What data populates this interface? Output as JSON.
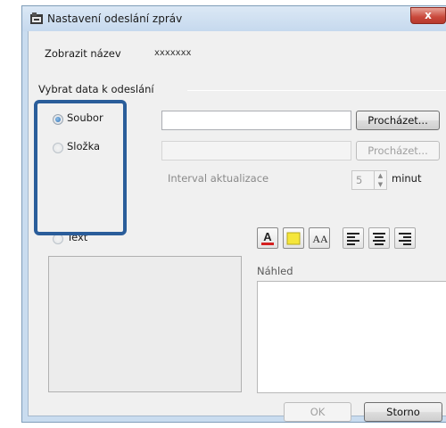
{
  "window": {
    "title": "Nastavení odeslání zpráv",
    "close_symbol": "x"
  },
  "display_name": {
    "label": "Zobrazit název",
    "value": "xxxxxxx"
  },
  "group": {
    "title": "Vybrat data k odeslání"
  },
  "options": {
    "file_label": "Soubor",
    "folder_label": "Složka",
    "text_label": "Text",
    "selected": "file"
  },
  "file_path": {
    "value": ""
  },
  "folder_path": {
    "value": ""
  },
  "browse_file_label": "Procházet...",
  "browse_folder_label": "Procházet...",
  "update_interval": {
    "label": "Interval aktualizace",
    "value": "5",
    "unit": "minut"
  },
  "formatting": {
    "text_color_glyph": "A",
    "font_size_glyph": "AA",
    "icons": [
      "text-color-icon",
      "background-color-icon",
      "font-size-icon",
      "align-left-icon",
      "align-center-icon",
      "align-right-icon"
    ]
  },
  "preview": {
    "label": "Náhled"
  },
  "footer": {
    "ok_label": "OK",
    "cancel_label": "Storno"
  },
  "colors": {
    "highlight_frame": "#2a5d9a",
    "text_color_underline": "#d42020",
    "background_swatch": "#f5e63a",
    "close_button": "#c9483a"
  }
}
